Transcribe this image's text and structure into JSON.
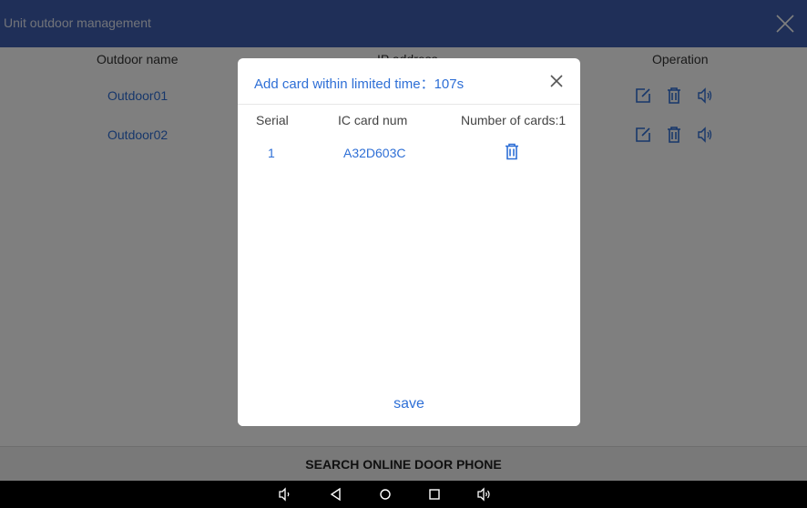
{
  "window": {
    "title": "Unit outdoor management"
  },
  "table": {
    "headers": {
      "name": "Outdoor name",
      "ip": "IP address",
      "operation": "Operation"
    },
    "rows": [
      {
        "name": "Outdoor01"
      },
      {
        "name": "Outdoor02"
      }
    ]
  },
  "search_button": "SEARCH ONLINE DOOR PHONE",
  "dialog": {
    "title": "Add card within limited time：107s",
    "columns": {
      "serial": "Serial",
      "card": "IC card num",
      "count": "Number of cards:1"
    },
    "cards": [
      {
        "serial": "1",
        "card": "A32D603C"
      }
    ],
    "save": "save"
  },
  "colors": {
    "accent": "#2e6fd6",
    "titlebar": "#3f5fb0"
  },
  "icons": [
    "close-icon",
    "edit-icon",
    "delete-icon",
    "speaker-icon",
    "volume-down-icon",
    "back-icon",
    "home-icon",
    "recents-icon",
    "volume-up-icon"
  ]
}
